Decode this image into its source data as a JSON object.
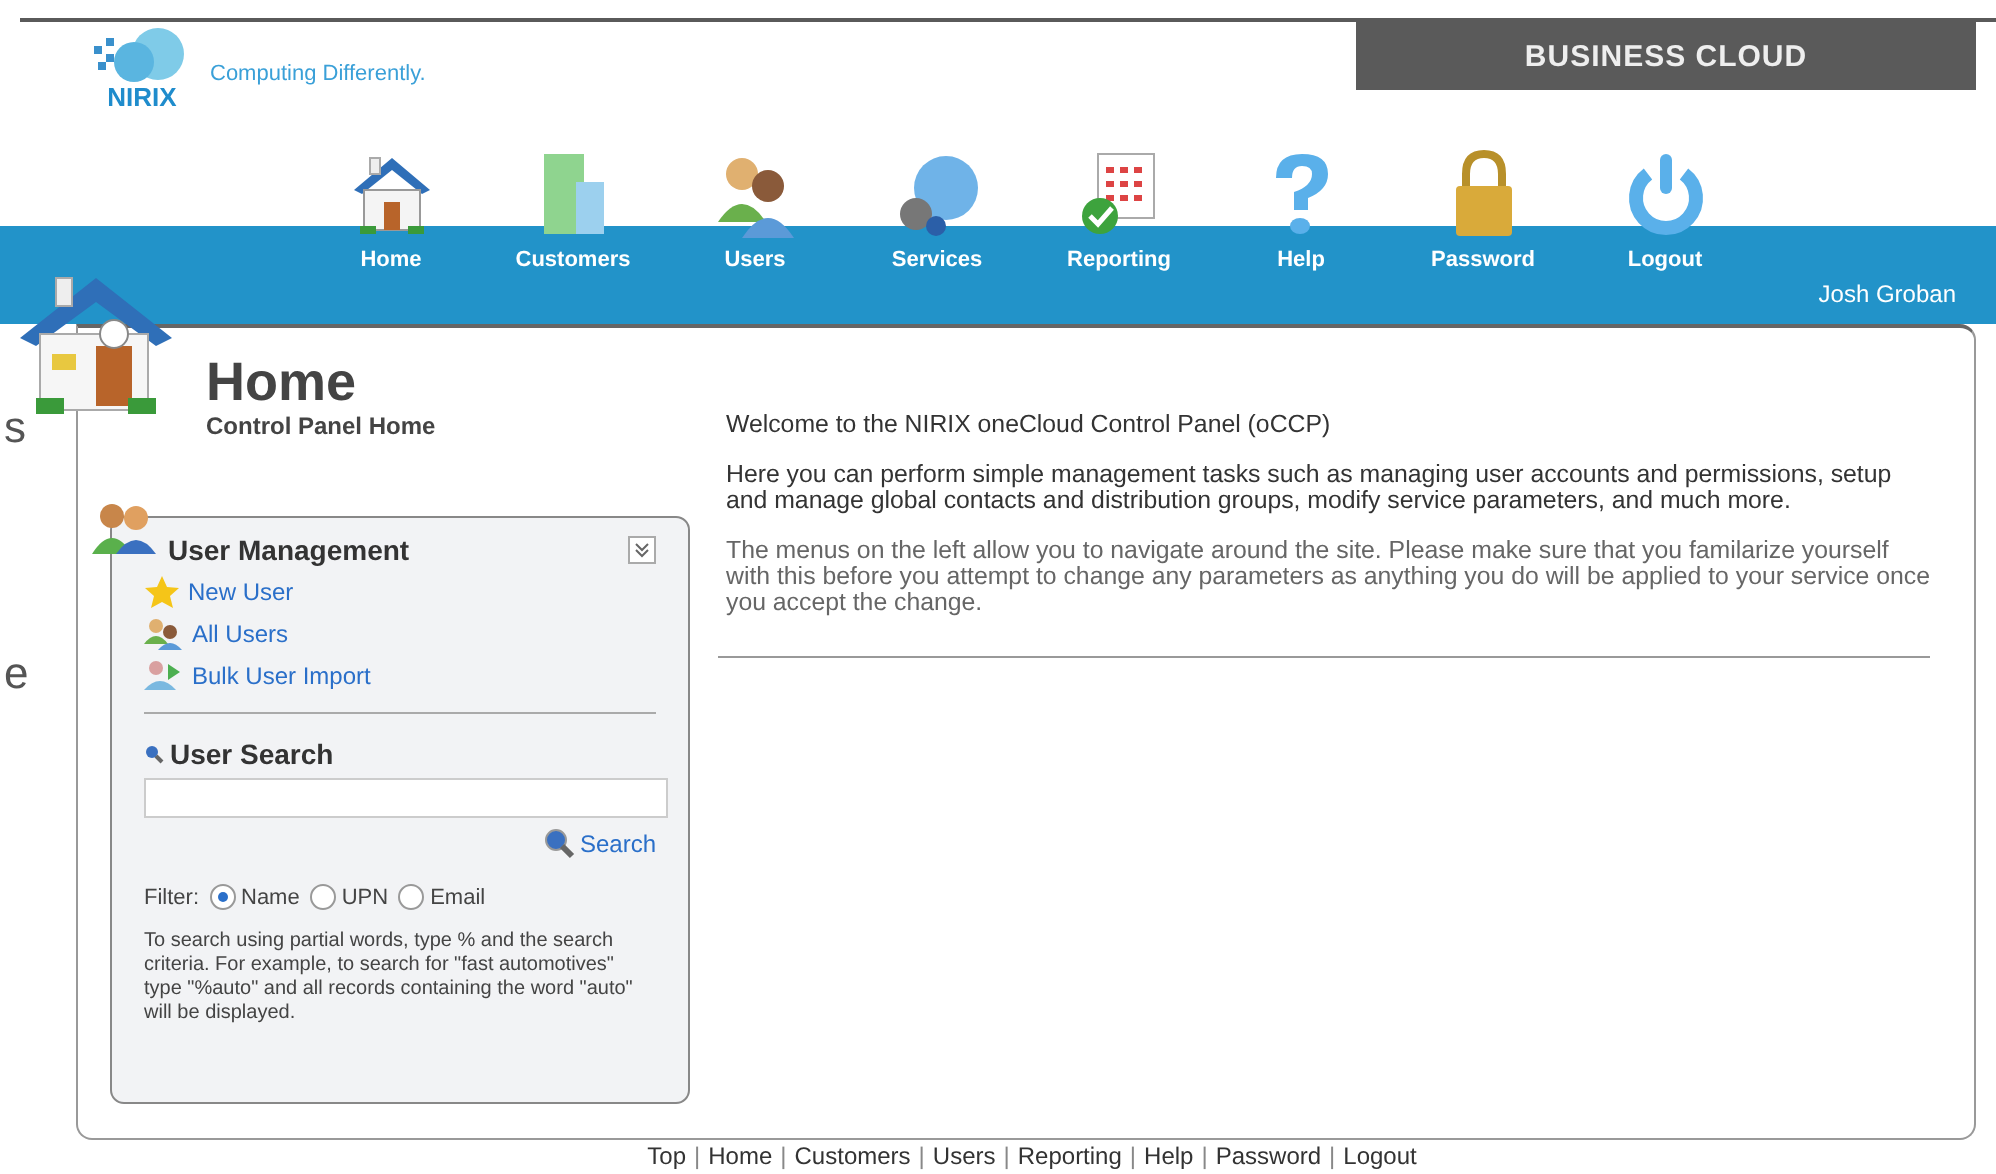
{
  "edge_fragments": [
    "s",
    "e"
  ],
  "logo": {
    "name": "NIRIX",
    "tagline": "Computing Differently."
  },
  "banner": {
    "label": "BUSINESS CLOUD"
  },
  "nav": [
    {
      "label": "Home",
      "kind": "home"
    },
    {
      "label": "Customers",
      "kind": "customers"
    },
    {
      "label": "Users",
      "kind": "users"
    },
    {
      "label": "Services",
      "kind": "services"
    },
    {
      "label": "Reporting",
      "kind": "reporting"
    },
    {
      "label": "Help",
      "kind": "help"
    },
    {
      "label": "Password",
      "kind": "password"
    },
    {
      "label": "Logout",
      "kind": "logout"
    }
  ],
  "user_name": "Josh Groban",
  "page": {
    "title": "Home",
    "subtitle": "Control Panel Home"
  },
  "user_management": {
    "title": "User Management",
    "links": [
      {
        "label": "New User",
        "kind": "star"
      },
      {
        "label": "All Users",
        "kind": "users"
      },
      {
        "label": "Bulk User Import",
        "kind": "import"
      }
    ]
  },
  "user_search": {
    "title": "User Search",
    "button": "Search",
    "filter_label": "Filter:",
    "filters": [
      {
        "label": "Name",
        "selected": true
      },
      {
        "label": "UPN",
        "selected": false
      },
      {
        "label": "Email",
        "selected": false
      }
    ],
    "help": "To search using partial words, type % and the search criteria. For example, to search for \"fast automotives\" type \"%auto\" and all records containing the word \"auto\" will be displayed."
  },
  "content": {
    "paragraphs": [
      "Welcome to the NIRIX oneCloud Control Panel (oCCP)",
      "Here you can perform simple management tasks such as managing user accounts and permissions, setup and manage global contacts and distribution groups, modify service parameters, and much more.",
      "The menus on the left allow you to navigate around the site. Please make sure that you familarize yourself with this before you attempt to change any parameters as anything you do will be applied to your service once you accept the change."
    ]
  },
  "footer": {
    "separator": "|",
    "links": [
      "Top",
      "Home",
      "Customers",
      "Users",
      "Reporting",
      "Help",
      "Password",
      "Logout"
    ]
  }
}
